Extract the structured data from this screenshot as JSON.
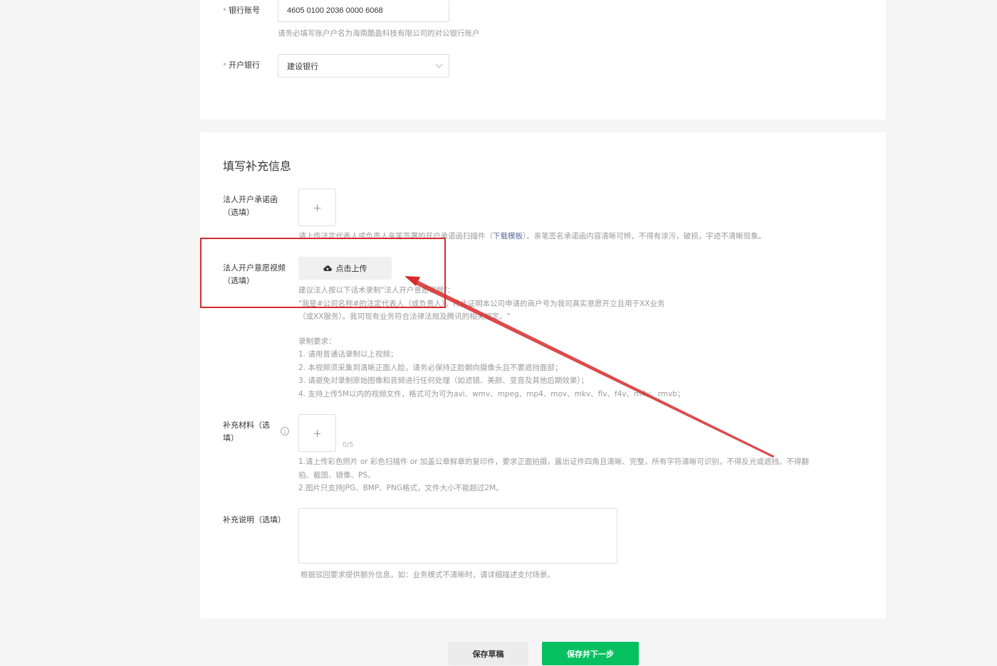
{
  "bank_account": {
    "label": "银行账号",
    "required_mark": "*",
    "value": "4605 0100 2036 0000 6068",
    "hint": "请务必填写账户户名为海南酷盈科技有限公司的对公银行账户"
  },
  "bank_name": {
    "label": "开户银行",
    "required_mark": "*",
    "value": "建设银行"
  },
  "section_title": "填写补充信息",
  "commitment_letter": {
    "label_line1": "法人开户承诺函",
    "label_line2": "（选填）",
    "upload_symbol": "+",
    "hint_before": "请上传法定代表人或负责人亲笔签署的开户承诺函扫描件（",
    "hint_link": "下载模板",
    "hint_after": "）。亲笔签名承诺函内容清晰可辨，不得有涂污，破损，字迹不清晰现象。"
  },
  "intent_video": {
    "label_line1": "法人开户意愿视频",
    "label_line2": "（选填）",
    "upload_button": "点击上传",
    "hint_lines": [
      "建议法人按以下话术录制\"法人开户意愿视频\"：",
      "\"我是#公司名称#的法定代表人（或负责人），特此证明本公司申请的商户号为我司真实意愿开立且用于XX业务",
      "（或XX服务）。我司现有业务符合法律法规及腾讯的相关规定。\""
    ],
    "requirements_title": "录制要求：",
    "requirements": [
      "1. 请用普通话录制以上视频；",
      "2. 本视频须采集到清晰正面人脸，请务必保持正脸朝向摄像头且不要遮挡面部；",
      "3. 请避免对录制原始图像和音频进行任何处理（如滤镜、美颜、变音及其他后期效果）；",
      "4. 支持上传5M以内的视频文件，格式可为可为avi、wmv、mpeg、mp4、mov、mkv、flv、f4v、m4v、rmvb；"
    ]
  },
  "supplementary_materials": {
    "label_line1": "补充材料（选",
    "label_line2": "填）",
    "info_symbol": "i",
    "upload_symbol": "+",
    "count": "0/5",
    "hint_lines": [
      "1.请上传彩色照片 or 彩色扫描件 or 加盖公章鲜章的复印件，要求正面拍摄，露出证件四角且清晰、完整，所有字符清晰可识别，不得反光或遮挡。不得翻",
      "拍、截图、镜像、PS。",
      "2.图片只支持JPG、BMP、PNG格式，文件大小不能超过2M。"
    ]
  },
  "supplementary_note": {
    "label": "补充说明（选填）",
    "value": "",
    "hint": "根据驳回要求提供额外信息，如：业务模式不清晰时，请详细描述支付场景。"
  },
  "buttons": {
    "save_draft": "保存草稿",
    "save_next": "保存并下一步"
  },
  "colors": {
    "primary": "#07c160",
    "link": "#576b95",
    "annotation": "#d62b2b"
  }
}
